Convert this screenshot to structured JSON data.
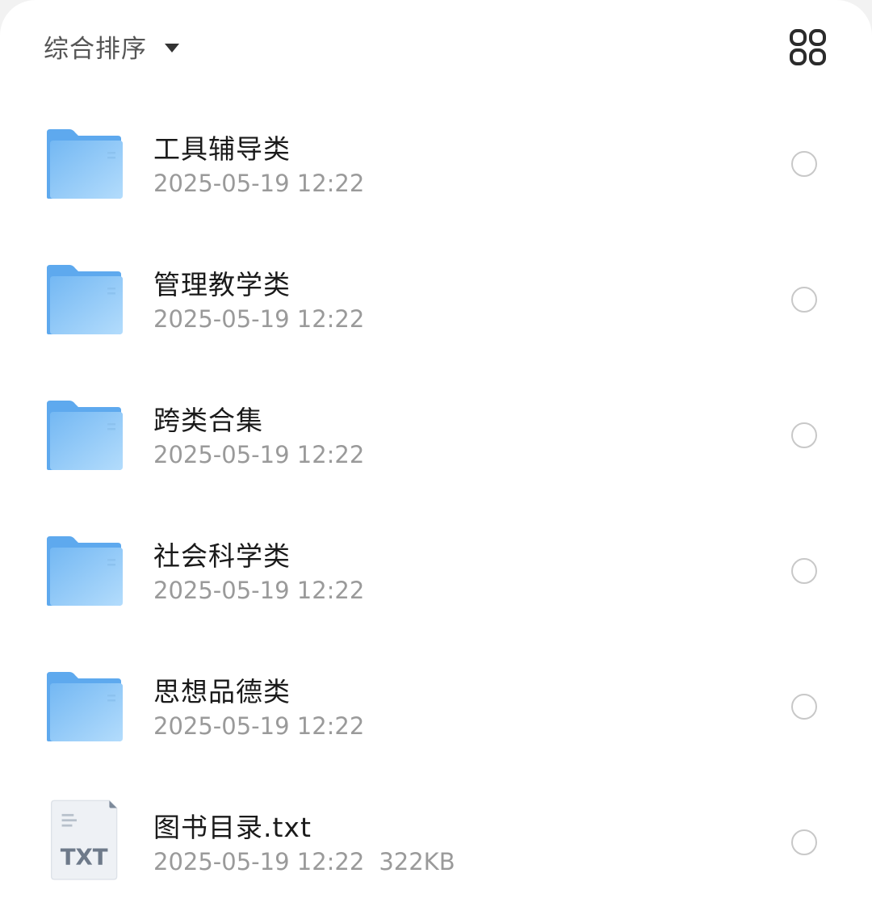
{
  "toolbar": {
    "sort_label": "综合排序",
    "sort_icon": "caret-down-icon",
    "view_toggle_icon": "grid-view-icon"
  },
  "colors": {
    "folder_blue": "#62aef0",
    "folder_light": "#a9d6fb",
    "text_primary": "#1a1a1a",
    "text_secondary": "#9a9a9a",
    "radio_border": "#c8c8c8"
  },
  "files": [
    {
      "name": "工具辅导类",
      "date": "2025-05-19 12:22",
      "type": "folder",
      "icon": "folder-icon"
    },
    {
      "name": "管理教学类",
      "date": "2025-05-19 12:22",
      "type": "folder",
      "icon": "folder-icon"
    },
    {
      "name": "跨类合集",
      "date": "2025-05-19 12:22",
      "type": "folder",
      "icon": "folder-icon"
    },
    {
      "name": "社会科学类",
      "date": "2025-05-19 12:22",
      "type": "folder",
      "icon": "folder-icon"
    },
    {
      "name": "思想品德类",
      "date": "2025-05-19 12:22",
      "type": "folder",
      "icon": "folder-icon"
    },
    {
      "name": "图书目录.txt",
      "date": "2025-05-19 12:22",
      "size": "322KB",
      "type": "txt",
      "icon": "txt-file-icon",
      "icon_label": "TXT"
    }
  ]
}
